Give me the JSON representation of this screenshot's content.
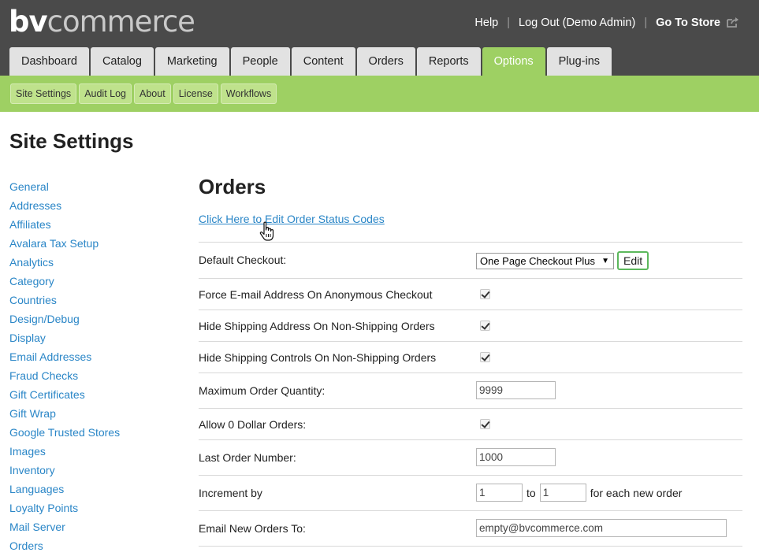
{
  "header": {
    "logo_bold": "bv",
    "logo_rest": "commerce",
    "links": {
      "help": "Help",
      "logout": "Log Out (Demo Admin)",
      "go_to_store": "Go To Store"
    },
    "separator": "|",
    "store_icon": "external-link-icon",
    "colors": {
      "bar": "#4a4a4a",
      "accent_green": "#9ed063",
      "link_blue": "#2a86c7"
    }
  },
  "tabs": [
    "Dashboard",
    "Catalog",
    "Marketing",
    "People",
    "Content",
    "Orders",
    "Reports",
    "Options",
    "Plug-ins"
  ],
  "active_tab": "Options",
  "subnav": [
    "Site Settings",
    "Audit Log",
    "About",
    "License",
    "Workflows"
  ],
  "page_title": "Site Settings",
  "sidebar": [
    "General",
    "Addresses",
    "Affiliates",
    "Avalara Tax Setup",
    "Analytics",
    "Category",
    "Countries",
    "Design/Debug",
    "Display",
    "Email Addresses",
    "Fraud Checks",
    "Gift Certificates",
    "Gift Wrap",
    "Google Trusted Stores",
    "Images",
    "Inventory",
    "Languages",
    "Loyalty Points",
    "Mail Server",
    "Orders"
  ],
  "main": {
    "title": "Orders",
    "status_link": "Click Here to Edit Order Status Codes",
    "cursor_icon": "hand-pointer-icon",
    "default_checkout": {
      "label": "Default Checkout:",
      "value": "One Page Checkout Plus",
      "edit": "Edit"
    },
    "force_email": {
      "label": "Force E-mail Address On Anonymous Checkout",
      "checked": true
    },
    "hide_shipping_address": {
      "label": "Hide Shipping Address On Non-Shipping Orders",
      "checked": true
    },
    "hide_shipping_controls": {
      "label": "Hide Shipping Controls On Non-Shipping Orders",
      "checked": true
    },
    "max_qty": {
      "label": "Maximum Order Quantity:",
      "value": "9999"
    },
    "allow_zero": {
      "label": "Allow 0 Dollar Orders:",
      "checked": true
    },
    "last_order": {
      "label": "Last Order Number:",
      "value": "1000"
    },
    "increment": {
      "label": "Increment by",
      "from": "1",
      "to_label": "to",
      "to": "1",
      "suffix": "for each new order"
    },
    "email_orders": {
      "label": "Email New Orders To:",
      "value": "empty@bvcommerce.com"
    }
  }
}
